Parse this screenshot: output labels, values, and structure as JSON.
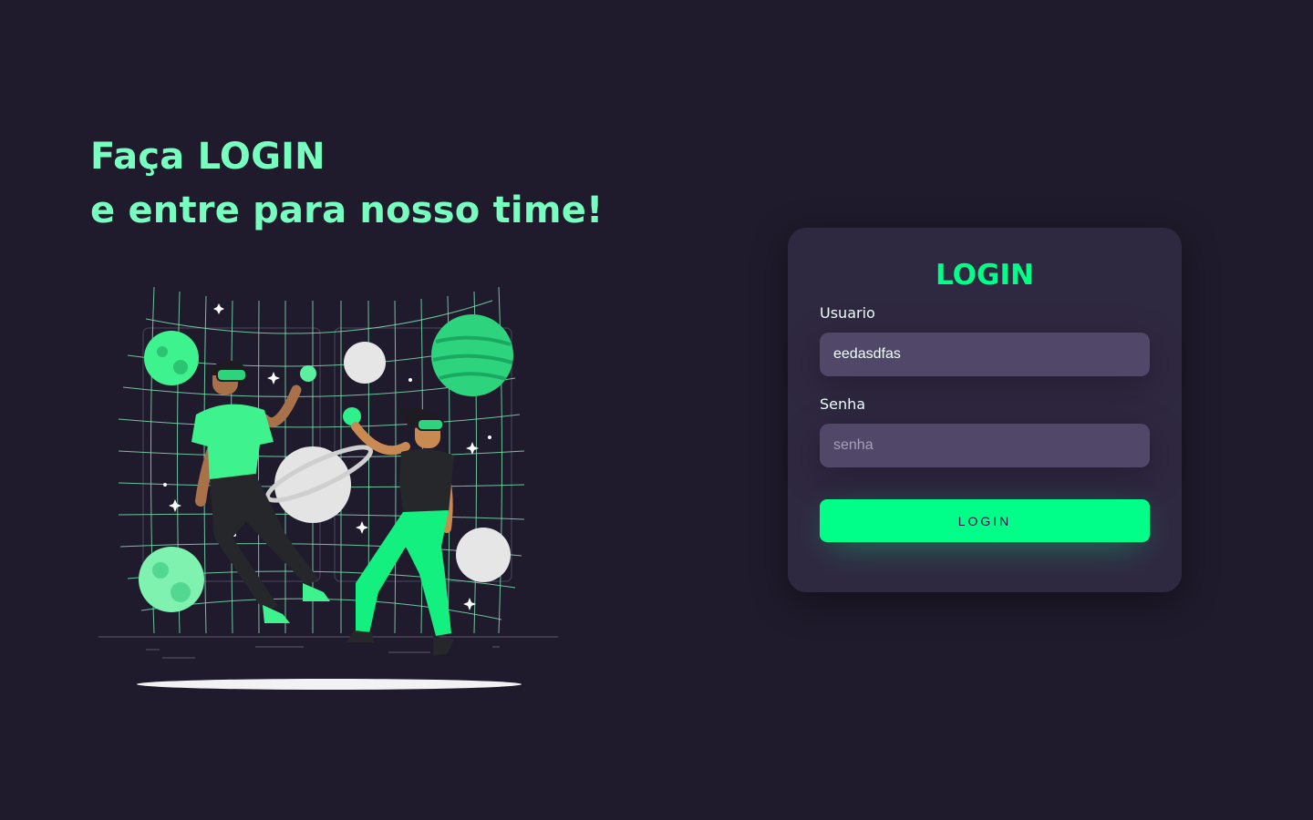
{
  "hero": {
    "line1": "Faça LOGIN",
    "line2": "e entre para nosso time!"
  },
  "illustration": {
    "description_icon": "vr-space-illustration-icon"
  },
  "login_card": {
    "title": "LOGIN",
    "username_label": "Usuario",
    "username_value": "eedasdfas",
    "password_label": "Senha",
    "password_placeholder": "senha",
    "password_value": "",
    "button_label": "Login"
  },
  "colors": {
    "background": "#201b2c",
    "card": "#2f2841",
    "input": "#514869",
    "accent": "#00ff88",
    "headline": "#77ffc0"
  }
}
